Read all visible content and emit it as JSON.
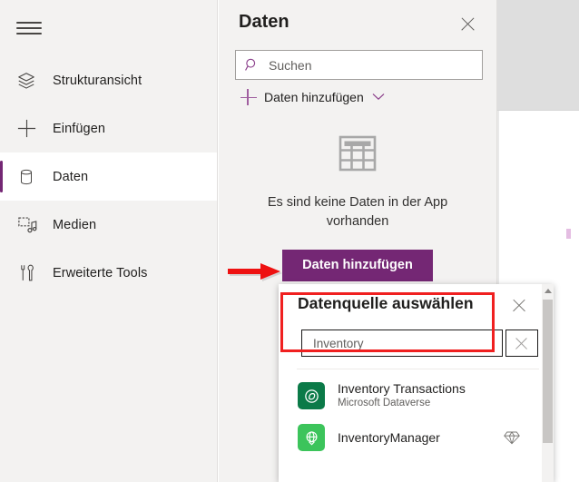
{
  "app": {
    "accent_color": "#742774",
    "panel_bg": "#f3f2f1",
    "annotation_color": "#f02020"
  },
  "sidebar": {
    "menu_button": "hamburger-menu",
    "items": [
      {
        "label": "Strukturansicht",
        "icon": "layers-icon",
        "active": false
      },
      {
        "label": "Einfügen",
        "icon": "plus-icon",
        "active": false
      },
      {
        "label": "Daten",
        "icon": "database-icon",
        "active": true
      },
      {
        "label": "Medien",
        "icon": "media-icon",
        "active": false
      },
      {
        "label": "Erweiterte Tools",
        "icon": "tools-icon",
        "active": false
      }
    ]
  },
  "panel": {
    "title": "Daten",
    "close_label": "×",
    "search": {
      "value": "",
      "placeholder": "Suchen"
    },
    "add_data": {
      "label": "Daten hinzufügen"
    },
    "empty_state": {
      "message": "Es sind keine Daten in der App vorhanden",
      "cta_label": "Daten hinzufügen"
    }
  },
  "dialog": {
    "title": "Datenquelle auswählen",
    "close_label": "×",
    "search": {
      "value": "Inventory",
      "placeholder": ""
    },
    "clear_label": "×",
    "sources": [
      {
        "name": "Inventory Transactions",
        "subtitle": "Microsoft Dataverse",
        "icon": "dataverse-icon",
        "icon_color": "#0b7a48",
        "premium": false
      },
      {
        "name": "InventoryManager",
        "subtitle": "",
        "icon": "connector-globe-icon",
        "icon_color": "#3cc45b",
        "premium": true
      }
    ]
  }
}
